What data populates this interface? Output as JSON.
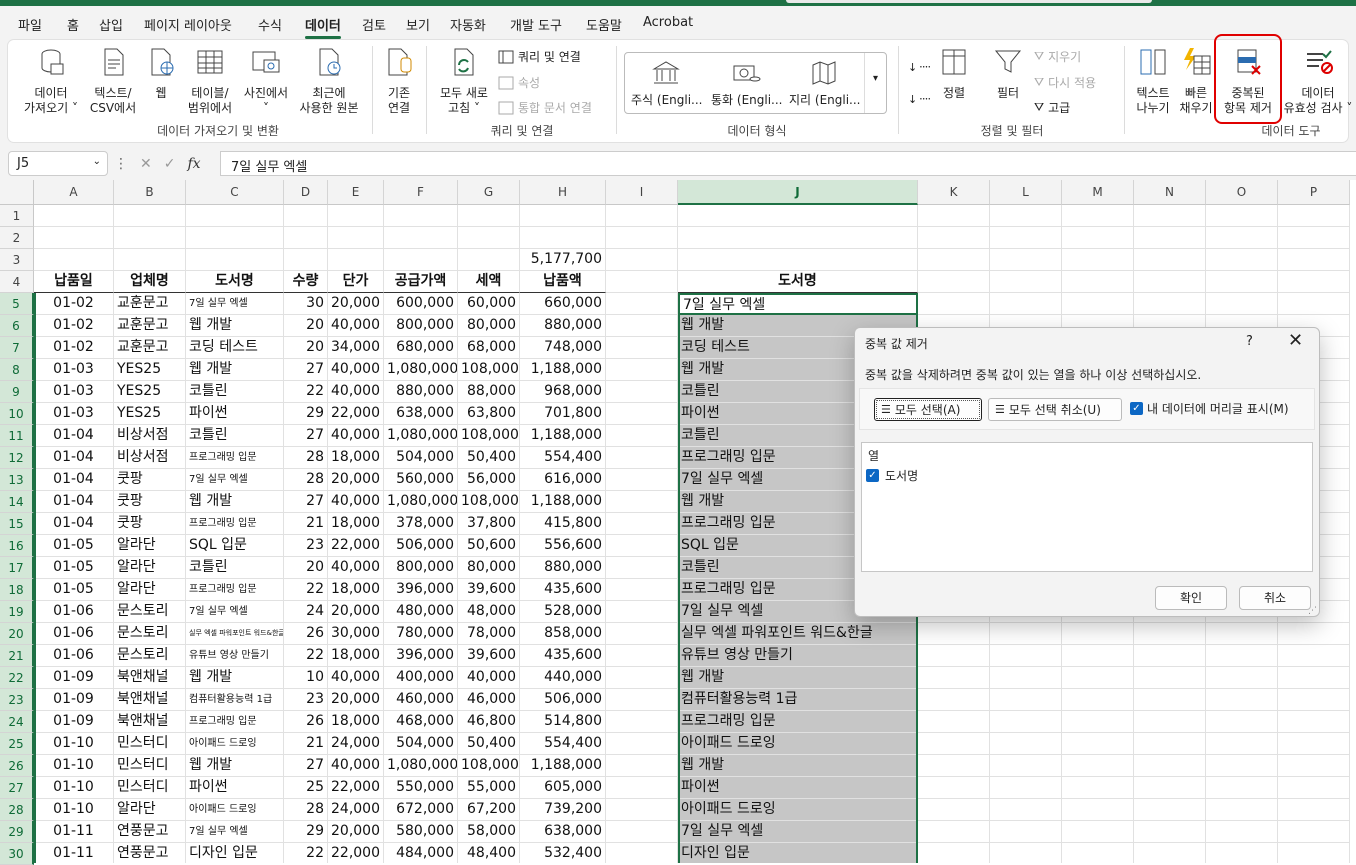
{
  "tabs": [
    "파일",
    "홈",
    "삽입",
    "페이지 레이아웃",
    "수식",
    "데이터",
    "검토",
    "보기",
    "자동화",
    "개발 도구",
    "도움말",
    "Acrobat"
  ],
  "active_tab": "데이터",
  "ribbon": {
    "get_data": {
      "label1": "데이터",
      "label2": "가져오기 ˅"
    },
    "text_csv": {
      "label1": "텍스트/",
      "label2": "CSV에서"
    },
    "web": {
      "label1": "웹"
    },
    "table_range": {
      "label1": "테이블/",
      "label2": "범위에서"
    },
    "from_picture": {
      "label1": "사진에서",
      "label2": "˅"
    },
    "recent_sources": {
      "label1": "최근에",
      "label2": "사용한 원본"
    },
    "existing_conn": {
      "label1": "기존",
      "label2": "연결"
    },
    "refresh_all": {
      "label1": "모두 새로",
      "label2": "고침 ˅"
    },
    "queries_conn": "쿼리 및 연결",
    "properties": "속성",
    "edit_links": "통합 문서 연결",
    "gallery": [
      "주식 (Engli...",
      "통화 (Engli...",
      "지리 (Engli..."
    ],
    "sort": "정렬",
    "filter": "필터",
    "clear": "지우기",
    "reapply": "다시 적용",
    "advanced": "고급",
    "text_to_columns": {
      "label1": "텍스트",
      "label2": "나누기"
    },
    "flash_fill": {
      "label1": "빠른",
      "label2": "채우기"
    },
    "remove_duplicates": {
      "label1": "중복된",
      "label2": "항목 제거"
    },
    "data_validation": {
      "label1": "데이터",
      "label2": "유효성 검사 ˅"
    },
    "groups": [
      "데이터 가져오기 및 변환",
      "쿼리 및 연결",
      "데이터 형식",
      "정렬 및 필터",
      "데이터 도구"
    ]
  },
  "formula_bar": {
    "name_box": "J5",
    "fx": "fx",
    "formula": "7일 실무 엑셀"
  },
  "columns": [
    "A",
    "B",
    "C",
    "D",
    "E",
    "F",
    "G",
    "H",
    "I",
    "J",
    "K",
    "L",
    "M",
    "N",
    "O",
    "P"
  ],
  "rows": [
    "1",
    "2",
    "3",
    "4",
    "5",
    "6",
    "7",
    "8",
    "9",
    "10",
    "11",
    "12",
    "13",
    "14",
    "15",
    "16",
    "17",
    "18",
    "19",
    "20",
    "21",
    "22",
    "23",
    "24",
    "25",
    "26",
    "27",
    "28",
    "29",
    "30"
  ],
  "total": "5,177,700",
  "headers": [
    "납품일",
    "업체명",
    "도서명",
    "수량",
    "단가",
    "공급가액",
    "세액",
    "납품액"
  ],
  "j_header": "도서명",
  "table": [
    [
      "01-02",
      "교훈문고",
      "7일 실무 엑셀",
      "30",
      "20,000",
      "600,000",
      "60,000",
      "660,000",
      "7일 실무 엑셀"
    ],
    [
      "01-02",
      "교훈문고",
      "웹 개발",
      "20",
      "40,000",
      "800,000",
      "80,000",
      "880,000",
      "웹 개발"
    ],
    [
      "01-02",
      "교훈문고",
      "코딩 테스트",
      "20",
      "34,000",
      "680,000",
      "68,000",
      "748,000",
      "코딩 테스트"
    ],
    [
      "01-03",
      "YES25",
      "웹 개발",
      "27",
      "40,000",
      "1,080,000",
      "108,000",
      "1,188,000",
      "웹 개발"
    ],
    [
      "01-03",
      "YES25",
      "코틀린",
      "22",
      "40,000",
      "880,000",
      "88,000",
      "968,000",
      "코틀린"
    ],
    [
      "01-03",
      "YES25",
      "파이썬",
      "29",
      "22,000",
      "638,000",
      "63,800",
      "701,800",
      "파이썬"
    ],
    [
      "01-04",
      "비상서점",
      "코틀린",
      "27",
      "40,000",
      "1,080,000",
      "108,000",
      "1,188,000",
      "코틀린"
    ],
    [
      "01-04",
      "비상서점",
      "프로그래밍 입문",
      "28",
      "18,000",
      "504,000",
      "50,400",
      "554,400",
      "프로그래밍 입문"
    ],
    [
      "01-04",
      "쿳팡",
      "7일 실무 엑셀",
      "28",
      "20,000",
      "560,000",
      "56,000",
      "616,000",
      "7일 실무 엑셀"
    ],
    [
      "01-04",
      "쿳팡",
      "웹 개발",
      "27",
      "40,000",
      "1,080,000",
      "108,000",
      "1,188,000",
      "웹 개발"
    ],
    [
      "01-04",
      "쿳팡",
      "프로그래밍 입문",
      "21",
      "18,000",
      "378,000",
      "37,800",
      "415,800",
      "프로그래밍 입문"
    ],
    [
      "01-05",
      "알라단",
      "SQL 입문",
      "23",
      "22,000",
      "506,000",
      "50,600",
      "556,600",
      "SQL 입문"
    ],
    [
      "01-05",
      "알라단",
      "코틀린",
      "20",
      "40,000",
      "800,000",
      "80,000",
      "880,000",
      "코틀린"
    ],
    [
      "01-05",
      "알라단",
      "프로그래밍 입문",
      "22",
      "18,000",
      "396,000",
      "39,600",
      "435,600",
      "프로그래밍 입문"
    ],
    [
      "01-06",
      "문스토리",
      "7일 실무 엑셀",
      "24",
      "20,000",
      "480,000",
      "48,000",
      "528,000",
      "7일 실무 엑셀"
    ],
    [
      "01-06",
      "문스토리",
      "실무 엑셀 파워포인트 워드&한글",
      "26",
      "30,000",
      "780,000",
      "78,000",
      "858,000",
      "실무 엑셀 파워포인트 워드&한글"
    ],
    [
      "01-06",
      "문스토리",
      "유튜브 영상 만들기",
      "22",
      "18,000",
      "396,000",
      "39,600",
      "435,600",
      "유튜브 영상 만들기"
    ],
    [
      "01-09",
      "북앤채널",
      "웹 개발",
      "10",
      "40,000",
      "400,000",
      "40,000",
      "440,000",
      "웹 개발"
    ],
    [
      "01-09",
      "북앤채널",
      "컴퓨터활용능력 1급",
      "23",
      "20,000",
      "460,000",
      "46,000",
      "506,000",
      "컴퓨터활용능력 1급"
    ],
    [
      "01-09",
      "북앤채널",
      "프로그래밍 입문",
      "26",
      "18,000",
      "468,000",
      "46,800",
      "514,800",
      "프로그래밍 입문"
    ],
    [
      "01-10",
      "민스터디",
      "아이패드 드로잉",
      "21",
      "24,000",
      "504,000",
      "50,400",
      "554,400",
      "아이패드 드로잉"
    ],
    [
      "01-10",
      "민스터디",
      "웹 개발",
      "27",
      "40,000",
      "1,080,000",
      "108,000",
      "1,188,000",
      "웹 개발"
    ],
    [
      "01-10",
      "민스터디",
      "파이썬",
      "25",
      "22,000",
      "550,000",
      "55,000",
      "605,000",
      "파이썬"
    ],
    [
      "01-10",
      "알라단",
      "아이패드 드로잉",
      "28",
      "24,000",
      "672,000",
      "67,200",
      "739,200",
      "아이패드 드로잉"
    ],
    [
      "01-11",
      "연풍문고",
      "7일 실무 엑셀",
      "29",
      "20,000",
      "580,000",
      "58,000",
      "638,000",
      "7일 실무 엑셀"
    ],
    [
      "01-11",
      "연풍문고",
      "디자인 입문",
      "22",
      "22,000",
      "484,000",
      "48,400",
      "532,400",
      "디자인 입문"
    ]
  ],
  "dialog": {
    "title": "중복 값 제거",
    "help": "?",
    "close": "✕",
    "description": "중복 값을 삭제하려면 중복 값이 있는 열을 하나 이상 선택하십시오.",
    "select_all": "모두 선택(A)",
    "unselect_all": "모두 선택 취소(U)",
    "has_headers": "내 데이터에 머리글 표시(M)",
    "list_header": "열",
    "list_items": [
      "도서명"
    ],
    "ok": "확인",
    "cancel": "취소"
  },
  "colors": {
    "accent": "#1e7145",
    "highlight": "#e00000",
    "checkbox": "#0c67c4"
  }
}
